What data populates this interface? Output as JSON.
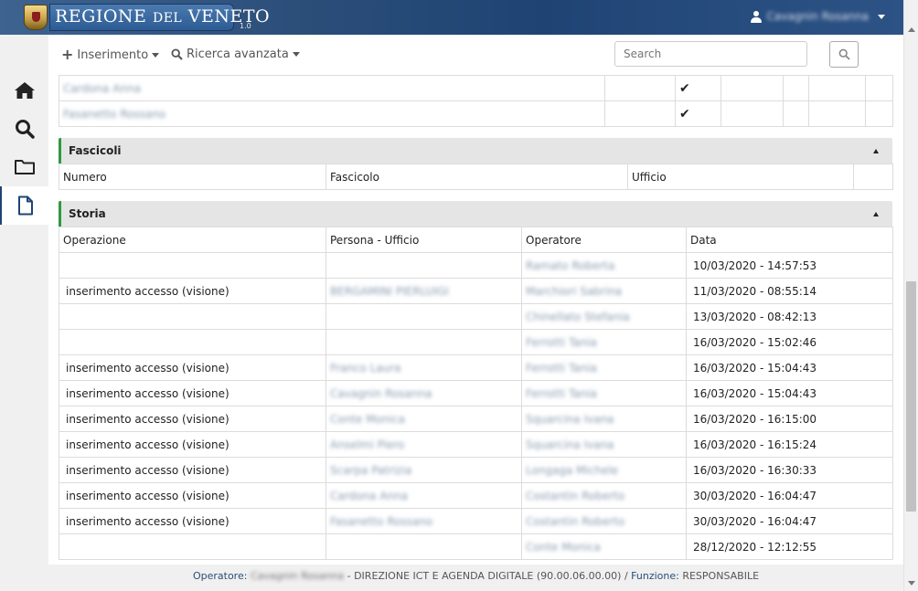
{
  "header": {
    "logo_text_main": "REGIONE",
    "logo_text_small": "DEL",
    "logo_text_end": "VENETO",
    "version": "1.0",
    "user_name": "Cavagnin Rosanna"
  },
  "sidebar": {
    "items": [
      {
        "name": "home",
        "icon": "home-icon"
      },
      {
        "name": "search",
        "icon": "search-icon"
      },
      {
        "name": "folder",
        "icon": "folder-icon"
      },
      {
        "name": "document",
        "icon": "document-icon"
      }
    ]
  },
  "toolbar": {
    "insert_label": "Inserimento",
    "advanced_search_label": "Ricerca avanzata",
    "search_placeholder": "Search"
  },
  "top_rows": [
    {
      "name": "Cardona Anna",
      "checked": "✔"
    },
    {
      "name": "Fasanetto Rossano",
      "checked": "✔"
    }
  ],
  "fascicoli": {
    "title": "Fascicoli",
    "columns": [
      "Numero",
      "Fascicolo",
      "Ufficio"
    ]
  },
  "storia": {
    "title": "Storia",
    "columns": [
      "Operazione",
      "Persona - Ufficio",
      "Operatore",
      "Data"
    ],
    "rows": [
      {
        "operazione": "",
        "persona": "",
        "operatore": "Ramato Roberta",
        "data": "10/03/2020 - 14:57:53"
      },
      {
        "operazione": "inserimento accesso  (visione)",
        "persona": "BERGAMINI PIERLUIGI",
        "operatore": "Marchiori Sabrina",
        "data": "11/03/2020 - 08:55:14"
      },
      {
        "operazione": "",
        "persona": "",
        "operatore": "Chinellato Stefania",
        "data": "13/03/2020 - 08:42:13"
      },
      {
        "operazione": "",
        "persona": "",
        "operatore": "Ferrotti Tania",
        "data": "16/03/2020 - 15:02:46"
      },
      {
        "operazione": "inserimento accesso  (visione)",
        "persona": "Franco Laura",
        "operatore": "Ferrotti Tania",
        "data": "16/03/2020 - 15:04:43"
      },
      {
        "operazione": "inserimento accesso  (visione)",
        "persona": "Cavagnin Rosanna",
        "operatore": "Ferrotti Tania",
        "data": "16/03/2020 - 15:04:43"
      },
      {
        "operazione": "inserimento accesso  (visione)",
        "persona": "Conte Monica",
        "operatore": "Squarcina Ivana",
        "data": "16/03/2020 - 16:15:00"
      },
      {
        "operazione": "inserimento accesso  (visione)",
        "persona": "Anselmi Piero",
        "operatore": "Squarcina Ivana",
        "data": "16/03/2020 - 16:15:24"
      },
      {
        "operazione": "inserimento accesso  (visione)",
        "persona": "Scarpa Patrizia",
        "operatore": "Longaga Michele",
        "data": "16/03/2020 - 16:30:33"
      },
      {
        "operazione": "inserimento accesso  (visione)",
        "persona": "Cardona Anna",
        "operatore": "Costantin Roberto",
        "data": "30/03/2020 - 16:04:47"
      },
      {
        "operazione": "inserimento accesso  (visione)",
        "persona": "Fasanetto Rossano",
        "operatore": "Costantin Roberto",
        "data": "30/03/2020 - 16:04:47"
      },
      {
        "operazione": "",
        "persona": "",
        "operatore": "Conte Monica",
        "data": "28/12/2020 - 12:12:55"
      }
    ]
  },
  "footer": {
    "operatore_label": "Operatore:",
    "operatore_name": "Cavagnin Rosanna",
    "department": "- DIREZIONE ICT E AGENDA DIGITALE (90.00.06.00.00)",
    "separator": "/",
    "funzione_label": "Funzione:",
    "funzione_value": "RESPONSABILE"
  },
  "colors": {
    "header_blue": "#1f4474",
    "section_green": "#2e9a3d",
    "footer_label": "#2a4d78"
  }
}
